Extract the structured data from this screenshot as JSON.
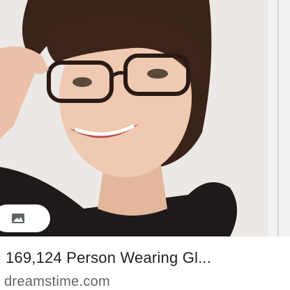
{
  "result": {
    "title": "169,124 Person Wearing Gl...",
    "source": "dreamstime.com",
    "badge_icon": "image-icon"
  },
  "colors": {
    "title": "#202124",
    "source": "#5f6368",
    "badge_bg": "#ffffff"
  }
}
